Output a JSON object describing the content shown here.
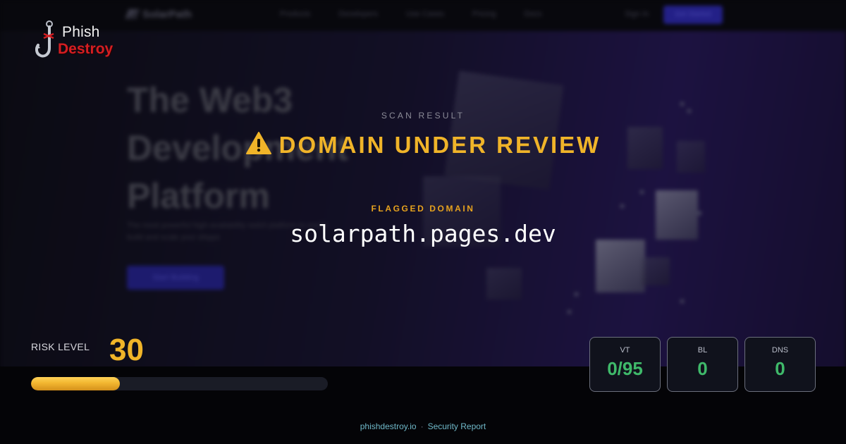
{
  "background_site": {
    "logo": "SolarPath",
    "nav_links": [
      "Products",
      "Developers",
      "Use Cases",
      "Pricing",
      "Docs"
    ],
    "sign_in": "Sign In",
    "cta": "Get Started",
    "hero_lines": [
      "The Web3",
      "Development",
      "Platform"
    ],
    "subtitle": "The most powerful high-availability web3 platform to easily build and scale your dApps",
    "hero_button": "Start Building"
  },
  "brand": {
    "line1": "Phish",
    "line2": "Destroy",
    "icon": "fishhook-icon"
  },
  "scan": {
    "label": "SCAN RESULT",
    "status": "DOMAIN UNDER REVIEW",
    "status_icon": "warning-icon",
    "status_color": "#f0b429"
  },
  "flagged": {
    "label": "FLAGGED DOMAIN",
    "domain": "solarpath.pages.dev"
  },
  "risk": {
    "label": "RISK LEVEL",
    "value": "30",
    "max": 100,
    "fraction": 0.3
  },
  "stats": [
    {
      "label": "VT",
      "value": "0/95"
    },
    {
      "label": "BL",
      "value": "0"
    },
    {
      "label": "DNS",
      "value": "0"
    }
  ],
  "footer": {
    "site": "phishdestroy.io",
    "separator": "·",
    "label": "Security Report"
  },
  "colors": {
    "warning": "#f0b429",
    "safe": "#3fb96a",
    "brand_red": "#d41e22"
  }
}
